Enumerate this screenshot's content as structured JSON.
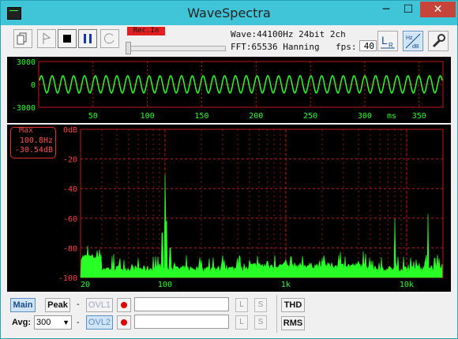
{
  "window": {
    "title": "WaveSpectra",
    "min": "─",
    "max": "☐",
    "close": "✕"
  },
  "toolbar": {
    "rec_badge": "Rec.In",
    "wave_info": "Wave:44100Hz 24bit 2ch",
    "fft_info": "FFT:65536 Hanning",
    "fps_label": "fps:",
    "fps_value": "40"
  },
  "icons": {
    "copy": "copy-icon",
    "marker": "marker-icon",
    "stop": "stop-icon",
    "pause": "pause-icon",
    "loop": "loop-icon",
    "lr": "lr-icon",
    "hzdb": "hz-db-icon",
    "settings": "wrench-icon"
  },
  "colors": {
    "grid": "#c01818",
    "trace": "#27ff27",
    "label_red": "#ff4040"
  },
  "waveform": {
    "y_ticks": [
      "3000",
      "0",
      "-3000"
    ],
    "x_ticks": [
      "50",
      "100",
      "150",
      "200",
      "250",
      "300",
      "350"
    ],
    "x_unit": "ms"
  },
  "spectrum": {
    "peak": {
      "title": "Max",
      "freq": "100.8Hz",
      "level": "-30.54dB"
    },
    "y_ticks": [
      "0dB",
      "-20",
      "-40",
      "-60",
      "-80",
      "-100"
    ],
    "x_ticks": [
      "20",
      "100",
      "1k",
      "10k"
    ]
  },
  "bottom": {
    "main": "Main",
    "peak": "Peak",
    "dash1": "-",
    "ovl1": "OVL1",
    "avg_label": "Avg:",
    "avg_value": "300",
    "dash2": "-",
    "ovl2": "OVL2",
    "l": "L",
    "s": "S",
    "thd": "THD",
    "rms": "RMS"
  }
}
